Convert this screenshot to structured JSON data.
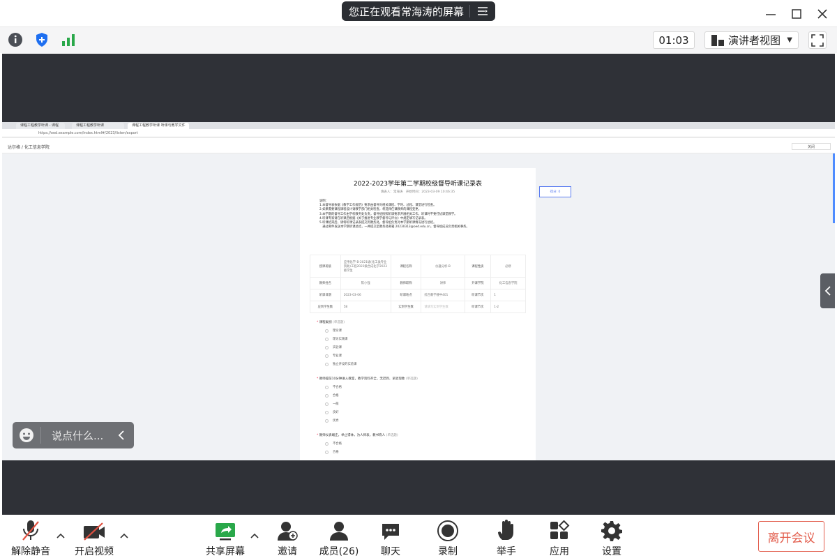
{
  "title_bar": {
    "share_banner": "您正在观看常海涛的屏幕"
  },
  "toolbar": {
    "timer": "01:03",
    "view_label": "演讲者视图"
  },
  "shared_screen": {
    "browser_tabs": [
      "课程工程教学听课 - 课程",
      "课程工程教学听课",
      "课程工程教学听课 听课与教学文件"
    ],
    "address": "https://oed.example.com/index.html#/2023/listen/export",
    "breadcrumb": "达尔格 / 化工信息学院",
    "close_label": "关闭",
    "score_label": "得分: 0",
    "document": {
      "title": "2022-2023学年第二学期校级督导听课记录表",
      "subtitle": "填表人：常海涛　开始时间：2023-03-09 10:46:35",
      "notes": [
        "说明：",
        "1.本督导表依据《教学工作规范》要求由督导对相关课程、学时、过程、课堂进行检查。",
        "2.如果需要课程课程设计请教学部门相关检查，将选择任课教师的课程变更。",
        "3.本学期的督导工作由学校教务处负责，督导组按照听课要求开展相关工作，听课时不要打扰课堂教学。",
        "4.听课专家请在听课后根据《关于推进专业教学督导与评价》中规定填写记录表。",
        "5.听课结束后，请将听课记录表提交到教务处，督导组负责对本学期听课情况进行总结。",
        "　通过邮件发送本学期听课总结，一并提交至教务处邮箱 20230313@oed.edu.cn，督导组成员负责相关事务。"
      ],
      "table": [
        [
          "授课班级",
          "应用化学-B-2021级(化工类专业资助)工程2022级合成化学2023级学生",
          "课程名称",
          "仪器分析-B",
          "课程性质",
          "必修"
        ],
        [
          "教师姓名",
          "陈小强",
          "教师职称",
          "讲师",
          "开课学院",
          "化工信息学院"
        ],
        [
          "听课日期",
          "2023-03-06",
          "听课地点",
          "综合教学楼中401",
          "听课节次",
          "1"
        ],
        [
          "应到学生数",
          "58",
          "实到学生数",
          "请填写实到学生数",
          "听课节次",
          "1-2"
        ]
      ],
      "questions": [
        {
          "label": "课程类别",
          "hint": "(单选题)",
          "options": [
            "理论课",
            "理论实践课",
            "实验课",
            "专业课",
            "独立开设的实验课"
          ]
        },
        {
          "label": "教师提前10分钟进入教室，教学资料齐全，无迟到、早退现象",
          "hint": "(单选题)",
          "options": [
            "不合格",
            "合格",
            "一般",
            "良好",
            "优秀"
          ]
        },
        {
          "label": "教师仪表端庄，举止得体，为人师表，教书育人",
          "hint": "(单选题)",
          "options": [
            "不合格",
            "合格"
          ]
        }
      ]
    }
  },
  "chat_input": {
    "placeholder": "说点什么..."
  },
  "bottom_bar": {
    "unmute": "解除静音",
    "start_video": "开启视频",
    "share_screen": "共享屏幕",
    "invite": "邀请",
    "members": "成员(26)",
    "chat": "聊天",
    "record": "录制",
    "raise_hand": "举手",
    "apps": "应用",
    "settings": "设置",
    "leave": "离开会议"
  },
  "colors": {
    "stage_bg": "#2f3137",
    "leave": "#e25b4a",
    "share_green": "#2aa84a",
    "mute_red": "#e05040"
  }
}
